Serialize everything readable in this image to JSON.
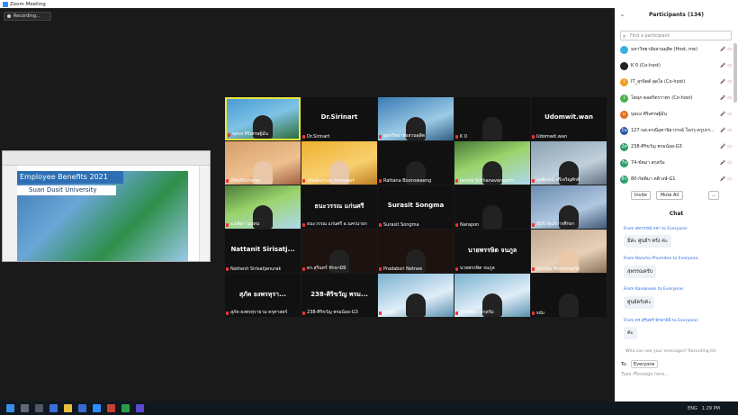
{
  "window": {
    "title": "Zoom Meeting",
    "controls": [
      "–",
      "□",
      "✕"
    ]
  },
  "recording": {
    "label": "Recording..."
  },
  "shared_slide": {
    "title": "Employee Benefits 2021",
    "university": "Suan Dusit University"
  },
  "tiles": [
    {
      "name": "บุษบง ศิริเศรษฐ์มั่น",
      "big": "",
      "style": "v1",
      "active": true
    },
    {
      "name": "Dr.Sirinart",
      "big": "Dr.Sirinart",
      "style": "dark"
    },
    {
      "name": "มหาวิทยาลัยสวนดุสิต",
      "big": "",
      "style": "v2"
    },
    {
      "name": "K 0",
      "big": "",
      "style": "dark"
    },
    {
      "name": "Udomwit.wan",
      "big": "Udomwit.wan",
      "style": "dark"
    },
    {
      "name": "OillyNicharas",
      "big": "",
      "style": "v4"
    },
    {
      "name": "chuanchom iamsaart",
      "big": "",
      "style": "v5"
    },
    {
      "name": "Rattana Boonswaeng",
      "big": "",
      "style": "dark"
    },
    {
      "name": "Janida Srithanavaraporn",
      "big": "",
      "style": "v3"
    },
    {
      "name": "นงลักษณ์ ศรีเจริญศักดิ์",
      "big": "",
      "style": "v6"
    },
    {
      "name": "อ.อลิสา บุญทน",
      "big": "",
      "style": "v3"
    },
    {
      "name": "ธนะวรรณ แก่นศรี อ.นครนายก",
      "big": "ธนะวรรณ แก่นศรี",
      "style": "dark"
    },
    {
      "name": "Surasit Songma",
      "big": "Surasit Songma",
      "style": "dark"
    },
    {
      "name": "Narapon",
      "big": "",
      "style": "dark"
    },
    {
      "name": "SDU ศูนย์การศึกษา",
      "big": "",
      "style": "v8"
    },
    {
      "name": "Nattanit Sirisatjanurak",
      "big": "Nattanit Sirisatj...",
      "style": "dark"
    },
    {
      "name": "ดร.สุรินทร์ ทักษามิมิ",
      "big": "",
      "style": "dark2"
    },
    {
      "name": "Pradabsri Netnee",
      "big": "",
      "style": "dark2"
    },
    {
      "name": "นายพรรษิต จนภูล",
      "big": "นายพรรษิต จนภูล",
      "style": "dark"
    },
    {
      "name": "Kanitja Nonthrachit",
      "big": "",
      "style": "v9"
    },
    {
      "name": "สุภัค ยงพรหุรายาม-ครุศาสตร์",
      "big": "สุภัค ยงพรหุรา...",
      "style": "dark"
    },
    {
      "name": "238-ศิริขวัญ พรมน้อย-G3",
      "big": "238-ศิริขวัญ พรม...",
      "style": "dark"
    },
    {
      "name": "J5007",
      "big": "",
      "style": "v10"
    },
    {
      "name": "74-ขัตมา สกุลรัม",
      "big": "",
      "style": "v10"
    },
    {
      "name": "sdu",
      "big": "",
      "style": "dark"
    }
  ],
  "participants": {
    "title": "Participants (134)",
    "search_placeholder": "Find a participant",
    "list": [
      {
        "name": "มหาวิทยาลัยสวนดุสิต (Host, me)",
        "initial": "",
        "color": "#3ab0e0"
      },
      {
        "name": "K 0 (Co-host)",
        "initial": "",
        "color": "#222"
      },
      {
        "name": "IT_สุรจิตต์ สุดใจ (Co-host)",
        "initial": "I",
        "color": "#f0a020"
      },
      {
        "name": "โตสุภ ตลสกิตรราพร (Co-host)",
        "initial": "I",
        "color": "#4caf50"
      },
      {
        "name": "บุษบง ศิริเศรษฐ์มั่น",
        "initial": "u",
        "color": "#e07020"
      },
      {
        "name": "127-นส.ดรณีอุทานิยาภรณ์ ใจภรุ-ครูบรร...",
        "initial": "1น",
        "color": "#2a5ba8"
      },
      {
        "name": "238-ศิริขวัญ พรมน้อย-G3",
        "initial": "2ศ",
        "color": "#2a9d6a"
      },
      {
        "name": "74-ขัตมา สกุลรัม",
        "initial": "7ข",
        "color": "#2a9d6a"
      },
      {
        "name": "80-กัตติมา คติวงษ์-G1",
        "initial": "8ก",
        "color": "#2a9d6a"
      }
    ],
    "invite": "Invite",
    "mute_all": "Mute All",
    "more": "..."
  },
  "chat": {
    "title": "Chat",
    "messages": [
      {
        "from": "From สุขาภรณ์ กสา to Everyone:",
        "text": "มีค่ะ ศูนย์ฯ ตรัง ค่ะ"
      },
      {
        "from": "From Bancha Phumdee to Everyone:",
        "text": "สุพรรณครับ"
      },
      {
        "from": "From Kanokwan to Everyone:",
        "text": "ศูนย์ตรังค่ะ"
      },
      {
        "from": "From ดร.สุรินทร์ ทักษามิมิ to Everyone:",
        "text": "ค่ะ"
      }
    ],
    "who_can_see": "Who can see your messages? Recording On",
    "to_label": "To:",
    "to_value": "Everyone",
    "placeholder": "Type message here..."
  },
  "taskbar": {
    "lang": "ENG",
    "time": "1:29 PM"
  }
}
